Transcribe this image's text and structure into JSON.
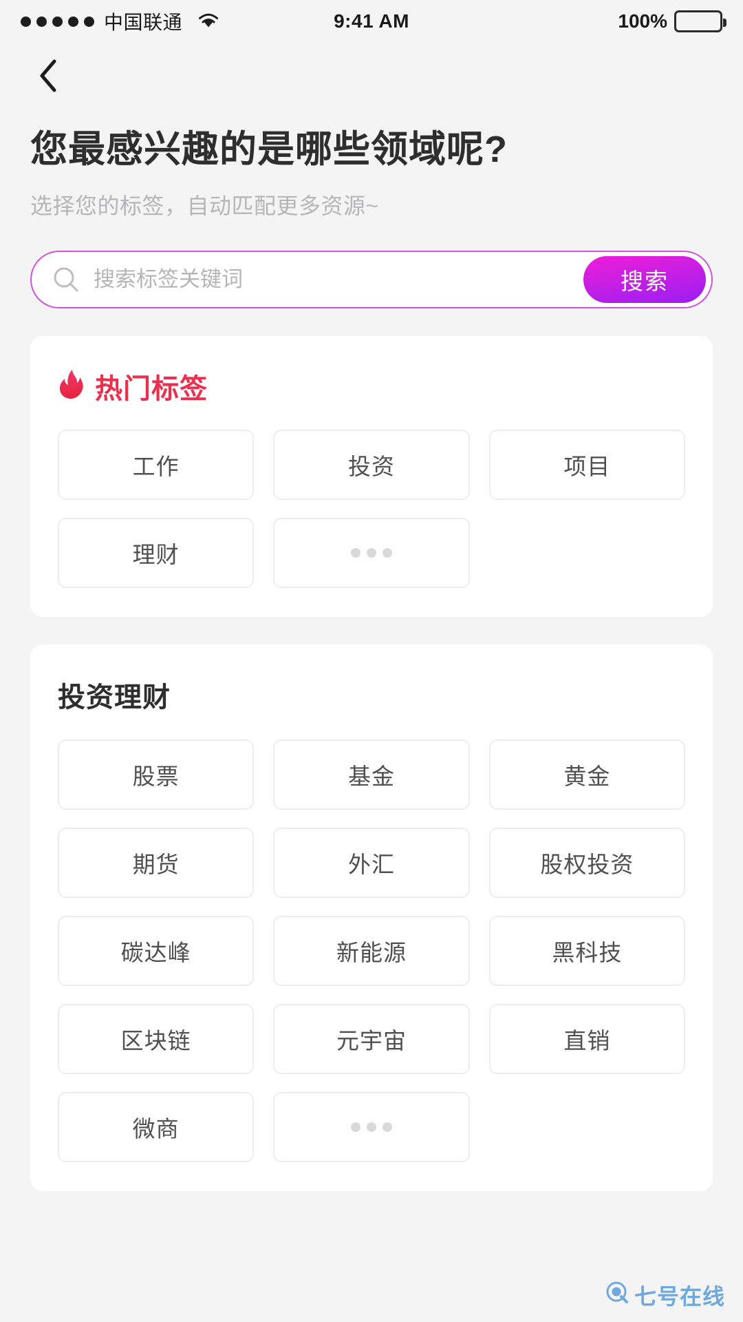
{
  "statusbar": {
    "carrier": "中国联通",
    "time": "9:41 AM",
    "battery_percent": "100%",
    "signal_dots": 5,
    "wifi_icon": "wifi-icon",
    "battery_icon": "battery-icon"
  },
  "nav": {
    "back_icon": "chevron-left-icon"
  },
  "header": {
    "title": "您最感兴趣的是哪些领域呢?",
    "subtitle": "选择您的标签，自动匹配更多资源~"
  },
  "search": {
    "placeholder": "搜索标签关键词",
    "value": "",
    "button_label": "搜索",
    "icon": "search-icon",
    "border_color": "#cf53d8",
    "button_gradient_from": "#f11bdb",
    "button_gradient_to": "#9b1ef3"
  },
  "hot_section": {
    "title": "热门标签",
    "icon": "flame-icon",
    "title_color": "#e8314f",
    "tags": [
      "工作",
      "投资",
      "项目",
      "理财"
    ],
    "more_label": "•••"
  },
  "invest_section": {
    "title": "投资理财",
    "tags": [
      "股票",
      "基金",
      "黄金",
      "期货",
      "外汇",
      "股权投资",
      "碳达峰",
      "新能源",
      "黑科技",
      "区块链",
      "元宇宙",
      "直销",
      "微商"
    ],
    "more_label": "•••"
  },
  "watermark": {
    "label": "七号在线",
    "icon": "q-logo-icon",
    "color": "#6ea8dc"
  }
}
